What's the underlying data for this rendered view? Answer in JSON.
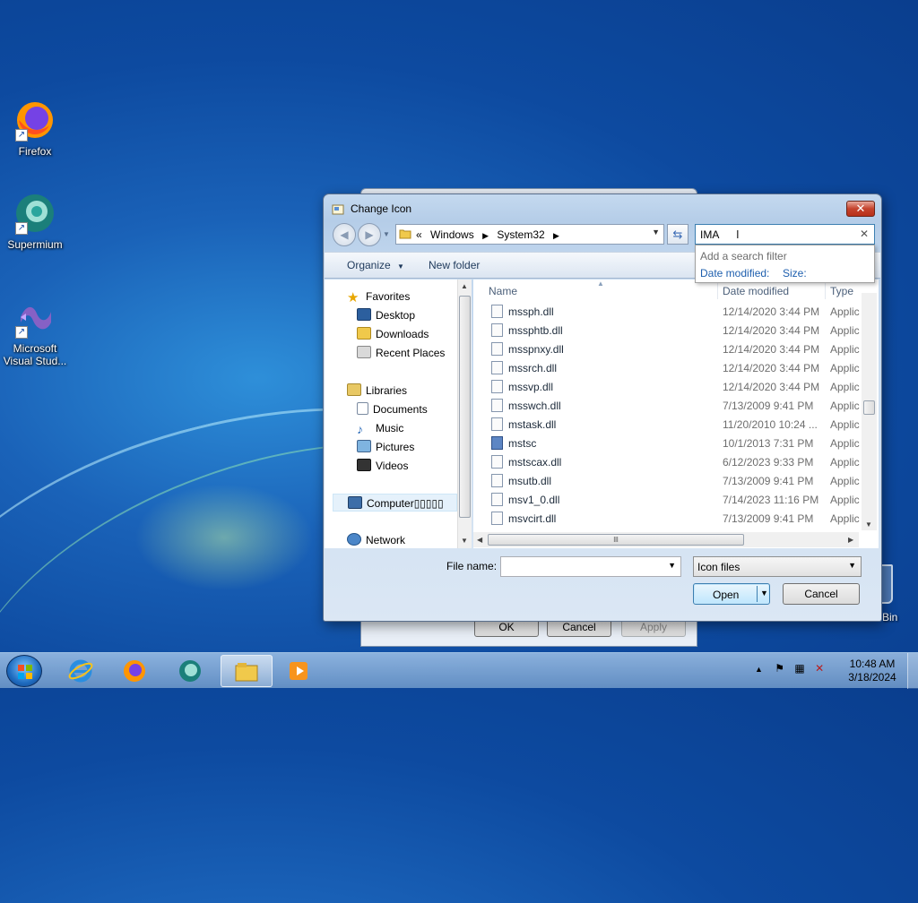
{
  "desktop": {
    "icons": [
      {
        "label": "Firefox",
        "icon": "firefox-icon"
      },
      {
        "label": "Supermium",
        "icon": "supermium-icon"
      },
      {
        "label": "Microsoft Visual Stud...",
        "icon": "visual-studio-icon"
      }
    ],
    "recycle_bin_partial": "Bin"
  },
  "back_dialog": {
    "ok_label": "OK",
    "cancel_label": "Cancel",
    "apply_label": "Apply"
  },
  "dialog": {
    "title": "Change Icon",
    "close_symbol": "✕",
    "address": {
      "overflow": "«",
      "crumbs": [
        "Windows",
        "System32"
      ]
    },
    "search": {
      "value": "IMA",
      "popup_hint": "Add a search filter",
      "filters": [
        "Date modified:",
        "Size:"
      ]
    },
    "toolbar": {
      "organize_label": "Organize",
      "new_folder_label": "New folder"
    },
    "nav": {
      "favorites": "Favorites",
      "desktop": "Desktop",
      "downloads": "Downloads",
      "recent_places": "Recent Places",
      "libraries": "Libraries",
      "documents": "Documents",
      "music": "Music",
      "pictures": "Pictures",
      "videos": "Videos",
      "computer": "Computer▯▯▯▯▯",
      "network": "Network"
    },
    "columns": {
      "name": "Name",
      "date_modified": "Date modified",
      "type": "Type"
    },
    "files": [
      {
        "name": "mssph.dll",
        "date": "12/14/2020 3:44 PM",
        "type": "Applic"
      },
      {
        "name": "mssphtb.dll",
        "date": "12/14/2020 3:44 PM",
        "type": "Applic"
      },
      {
        "name": "msspnxy.dll",
        "date": "12/14/2020 3:44 PM",
        "type": "Applic"
      },
      {
        "name": "mssrch.dll",
        "date": "12/14/2020 3:44 PM",
        "type": "Applic"
      },
      {
        "name": "mssvp.dll",
        "date": "12/14/2020 3:44 PM",
        "type": "Applic"
      },
      {
        "name": "msswch.dll",
        "date": "7/13/2009 9:41 PM",
        "type": "Applic"
      },
      {
        "name": "mstask.dll",
        "date": "11/20/2010 10:24 ...",
        "type": "Applic"
      },
      {
        "name": "mstsc",
        "date": "10/1/2013 7:31 PM",
        "type": "Applic"
      },
      {
        "name": "mstscax.dll",
        "date": "6/12/2023 9:33 PM",
        "type": "Applic"
      },
      {
        "name": "msutb.dll",
        "date": "7/13/2009 9:41 PM",
        "type": "Applic"
      },
      {
        "name": "msv1_0.dll",
        "date": "7/14/2023 11:16 PM",
        "type": "Applic"
      },
      {
        "name": "msvcirt.dll",
        "date": "7/13/2009 9:41 PM",
        "type": "Applic"
      }
    ],
    "filename_label": "File name:",
    "filename_value": "",
    "filetype_value": "Icon files",
    "open_label": "Open",
    "cancel_label": "Cancel"
  },
  "taskbar": {
    "apps": [
      "internet-explorer-icon",
      "firefox-icon",
      "supermium-icon",
      "file-explorer-icon",
      "media-player-icon"
    ],
    "time": "10:48 AM",
    "date": "3/18/2024"
  },
  "colors": {
    "accent": "#3c7fb1",
    "title_bar": "#b5cde8",
    "close_red": "#c5432d"
  }
}
